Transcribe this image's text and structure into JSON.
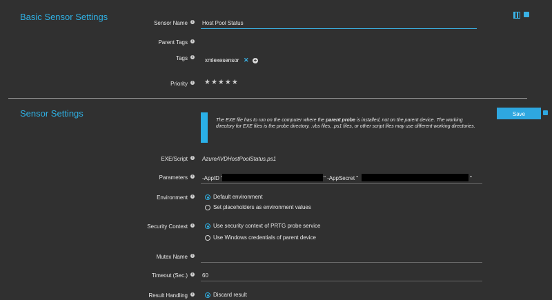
{
  "basic": {
    "title": "Basic Sensor Settings",
    "sensor_name_label": "Sensor Name",
    "sensor_name_value": "Host Pool Status",
    "parent_tags_label": "Parent Tags",
    "tags_label": "Tags",
    "tag_value": "xmlexesensor",
    "priority_label": "Priority",
    "priority_stars": "★★★★★",
    "priority_value": 5
  },
  "sensor": {
    "title": "Sensor Settings",
    "info_part1": "The EXE file has to run on the computer where the ",
    "info_bold": "parent probe",
    "info_part2": " is installed, not on the parent device. The working directory for EXE files is the probe directory. .vbs files, .ps1 files, or other script files may use different working directories.",
    "save_label": "Save",
    "exe_label": "EXE/Script",
    "exe_value": "AzureAVDHostPoolStatus.ps1",
    "params_label": "Parameters",
    "params_prefix": "-AppID \"",
    "params_mid": "\" -AppSecret \"",
    "params_suffix": "\"",
    "environment_label": "Environment",
    "env_option1": "Default environment",
    "env_option2": "Set placeholders as environment values",
    "security_label": "Security Context",
    "sec_option1": "Use security context of PRTG probe service",
    "sec_option2": "Use Windows credentials of parent device",
    "mutex_label": "Mutex Name",
    "mutex_value": "",
    "timeout_label": "Timeout (Sec.)",
    "timeout_value": "60",
    "result_label": "Result Handling",
    "result_option1": "Discard result"
  },
  "colors": {
    "accent": "#2fb0e3",
    "background": "#303030"
  },
  "icons": {
    "info": "info-icon",
    "config": "config-icon",
    "print": "print-icon",
    "remove_tag": "close-icon",
    "add_tag": "plus-icon",
    "save": "save-icon"
  }
}
